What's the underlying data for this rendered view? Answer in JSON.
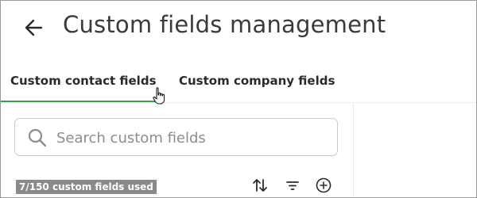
{
  "header": {
    "back_icon": "arrow-left-icon",
    "title": "Custom fields management"
  },
  "tabs": [
    {
      "label": "Custom contact fields",
      "active": true
    },
    {
      "label": "Custom company fields",
      "active": false
    }
  ],
  "search": {
    "placeholder": "Search custom fields",
    "value": "",
    "icon": "search-icon"
  },
  "usage": {
    "text": "7/150 custom fields used",
    "used": 7,
    "limit": 150
  },
  "toolbar": {
    "sort_icon": "sort-icon",
    "filter_icon": "filter-icon",
    "add_icon": "add-circle-icon"
  },
  "colors": {
    "accent": "#3c9a4f",
    "badge_bg": "#8a8a8a",
    "text": "#2b2b2b",
    "border": "#c9c9c9"
  }
}
